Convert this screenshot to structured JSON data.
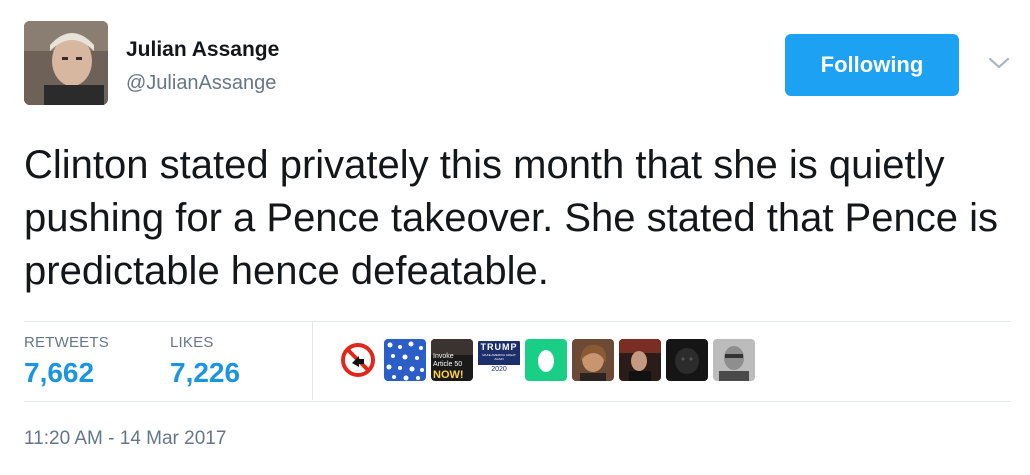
{
  "author": {
    "name": "Julian Assange",
    "handle": "@JulianAssange"
  },
  "follow_button": {
    "label": "Following"
  },
  "tweet": {
    "text": "Clinton stated privately this month that she is quietly pushing for a Pence takeover. She stated that Pence is predictable hence defeatable."
  },
  "stats": {
    "retweets_label": "RETWEETS",
    "retweets_value": "7,662",
    "likes_label": "LIKES",
    "likes_value": "7,226"
  },
  "likers": {
    "badge_invoke": "Invoke Article 50",
    "badge_now": "NOW!",
    "badge_trump": "TRUMP",
    "badge_trump_sub": "MAKE AMERICA GREAT AGAIN",
    "badge_year": "2020"
  },
  "timestamp": "11:20 AM - 14 Mar 2017",
  "colors": {
    "accent": "#1da1f2",
    "stat_value": "#1b95e0",
    "muted": "#657786"
  }
}
